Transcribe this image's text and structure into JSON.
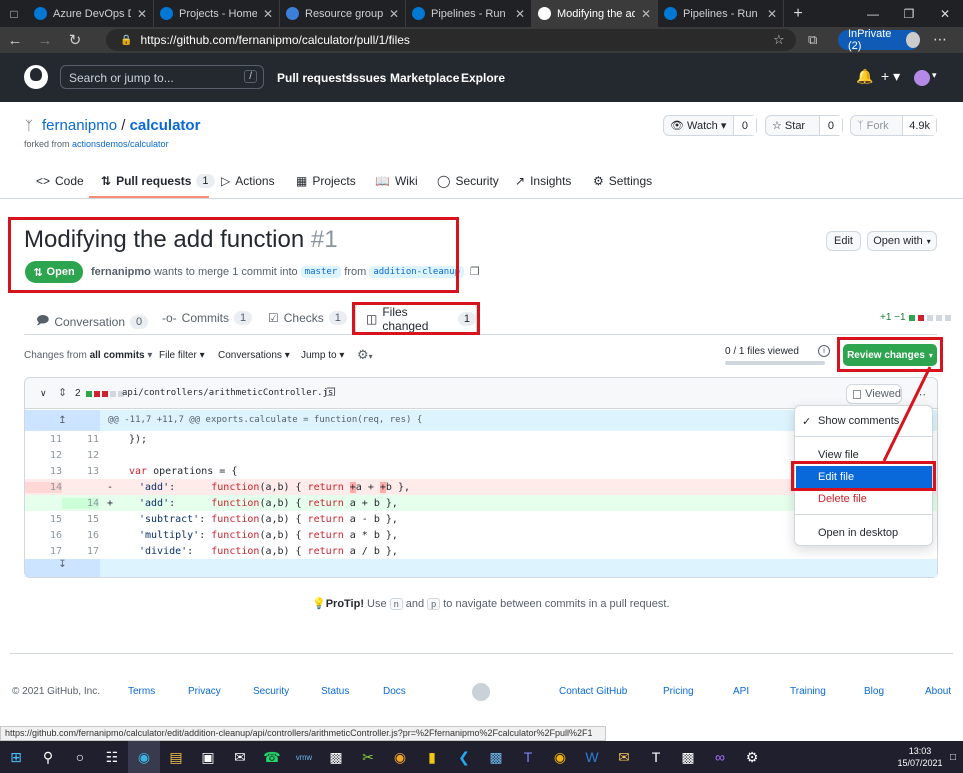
{
  "browser": {
    "tabs": [
      {
        "label": "Azure DevOps Dem",
        "color": "#0078d4"
      },
      {
        "label": "Projects - Home",
        "color": "#0078d4"
      },
      {
        "label": "Resource groups - M",
        "color": "#3c7fd8"
      },
      {
        "label": "Pipelines - Run 202",
        "color": "#0078d4"
      },
      {
        "label": "Modifying the add",
        "color": "#ffffff"
      },
      {
        "label": "Pipelines - Run 202",
        "color": "#0078d4"
      }
    ],
    "url": "https://github.com/fernanipmo/calculator/pull/1/files",
    "inprivate": "InPrivate (2)"
  },
  "gh": {
    "search_placeholder": "Search or jump to...",
    "search_key": "/",
    "nav": [
      "Pull requests",
      "Issues",
      "Marketplace",
      "Explore"
    ]
  },
  "repo": {
    "owner": "fernanipmo",
    "sep": "/",
    "name": "calculator",
    "forked_prefix": "forked from ",
    "forked_from": "actionsdemos/calculator",
    "watch": "Watch",
    "watch_count": "0",
    "star": "Star",
    "star_count": "0",
    "fork": "Fork",
    "fork_count": "4.9k",
    "tabs": {
      "code": "Code",
      "pulls": "Pull requests",
      "pulls_count": "1",
      "actions": "Actions",
      "projects": "Projects",
      "wiki": "Wiki",
      "security": "Security",
      "insights": "Insights",
      "settings": "Settings"
    }
  },
  "pr": {
    "title": "Modifying the add function",
    "number": "#1",
    "state": "Open",
    "author": "fernanipmo",
    "merge_text": " wants to merge 1 commit into ",
    "base": "master",
    "from": " from ",
    "head": "addition-cleanup",
    "edit": "Edit",
    "open_with": "Open with",
    "tabs": {
      "conversation": "Conversation",
      "conversation_count": "0",
      "commits": "Commits",
      "commits_count": "1",
      "checks": "Checks",
      "checks_count": "1",
      "files": "Files changed",
      "files_count": "1"
    },
    "diffstat": "+1 −1"
  },
  "toolbar": {
    "changes_from": "Changes from ",
    "all_commits": "all commits",
    "file_filter": "File filter",
    "conversations": "Conversations",
    "jump_to": "Jump to",
    "files_viewed": "0 / 1 files viewed",
    "review": "Review changes"
  },
  "file": {
    "changes": "2",
    "path": "api/controllers/arithmeticController.js",
    "viewed": "Viewed",
    "hunk": "@@ -11,7 +11,7 @@ exports.calculate = function(req, res) {"
  },
  "menu": {
    "show_comments": "Show comments",
    "view_file": "View file",
    "edit_file": "Edit file",
    "delete_file": "Delete file",
    "open_desktop": "Open in desktop"
  },
  "protip": {
    "label": "ProTip!",
    "t1": " Use ",
    "k1": "n",
    "t2": " and ",
    "k2": "p",
    "t3": " to navigate between commits in a pull request."
  },
  "footer": {
    "copyright": "© 2021 GitHub, Inc.",
    "links": [
      "Terms",
      "Privacy",
      "Security",
      "Status",
      "Docs",
      "Contact GitHub",
      "Pricing",
      "API",
      "Training",
      "Blog",
      "About"
    ]
  },
  "statusbar": "https://github.com/fernanipmo/calculator/edit/addition-cleanup/api/controllers/arithmeticController.js?pr=%2Ffernanipmo%2Fcalculator%2Fpull%2F1",
  "taskbar": {
    "time": "13:03",
    "date": "15/07/2021"
  }
}
